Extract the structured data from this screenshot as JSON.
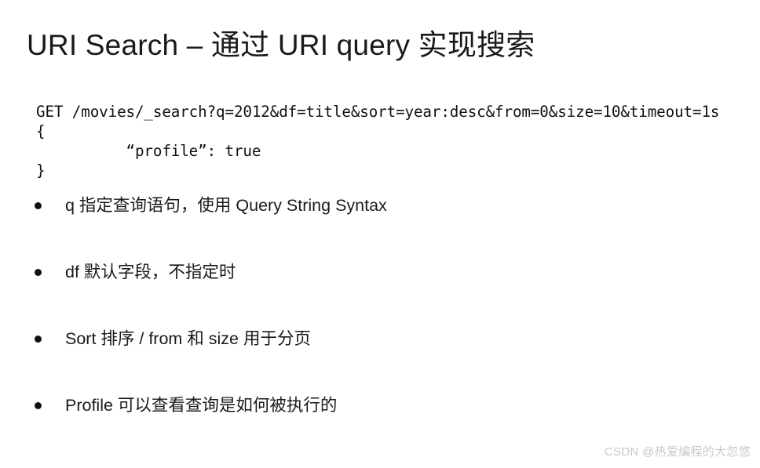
{
  "slide": {
    "title": "URI Search – 通过 URI query 实现搜索",
    "background_color": "#ffffff",
    "text_color": "#1a1a1a"
  },
  "code": {
    "lines": [
      "GET /movies/_search?q=2012&df=title&sort=year:desc&from=0&size=10&timeout=1s",
      "{",
      "          “profile”: true",
      "}"
    ]
  },
  "bullets": [
    {
      "marker": "bullet-dot",
      "text": "q 指定查询语句，使用 Query String Syntax"
    },
    {
      "marker": "bullet-dot",
      "text": "df 默认字段，不指定时"
    },
    {
      "marker": "bullet-dot",
      "text": "Sort 排序 / from 和 size 用于分页"
    },
    {
      "marker": "bullet-dot",
      "text": "Profile 可以查看查询是如何被执行的"
    }
  ],
  "watermark": {
    "text": "CSDN @热爱编程的大忽悠",
    "color": "#c9c9c9"
  }
}
